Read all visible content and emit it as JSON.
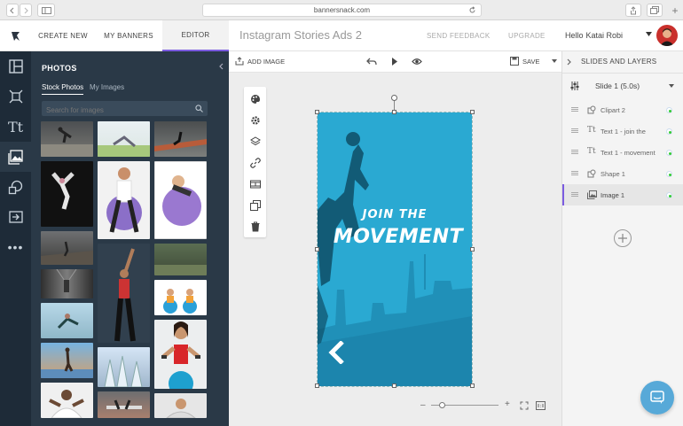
{
  "browser": {
    "url": "bannersnack.com"
  },
  "header": {
    "tabs": [
      {
        "label": "CREATE NEW"
      },
      {
        "label": "MY BANNERS"
      },
      {
        "label": "EDITOR"
      }
    ],
    "title": "Instagram Stories Ads 2",
    "send_feedback": "SEND FEEDBACK",
    "upgrade": "UPGRADE",
    "hello": "Hello",
    "user": "Katai Robi"
  },
  "panel": {
    "title": "PHOTOS",
    "tabs": [
      {
        "label": "Stock Photos"
      },
      {
        "label": "My Images"
      }
    ],
    "search_placeholder": "Search for images"
  },
  "toolbar": {
    "add_image": "ADD IMAGE",
    "save": "SAVE"
  },
  "banner": {
    "line1": "JOIN THE",
    "line2": "MOVEMENT",
    "color": "#2aa9d2"
  },
  "right_panel": {
    "title": "SLIDES AND LAYERS",
    "slide": "Slide 1 (5.0s)",
    "layers": [
      {
        "label": "Clipart 2",
        "icon": "clipart-icon"
      },
      {
        "label": "Text 1 - join the",
        "icon": "text-icon"
      },
      {
        "label": "Text 1 - movement",
        "icon": "text-icon"
      },
      {
        "label": "Shape 1",
        "icon": "shape-icon"
      },
      {
        "label": "Image 1",
        "icon": "image-icon"
      }
    ]
  }
}
